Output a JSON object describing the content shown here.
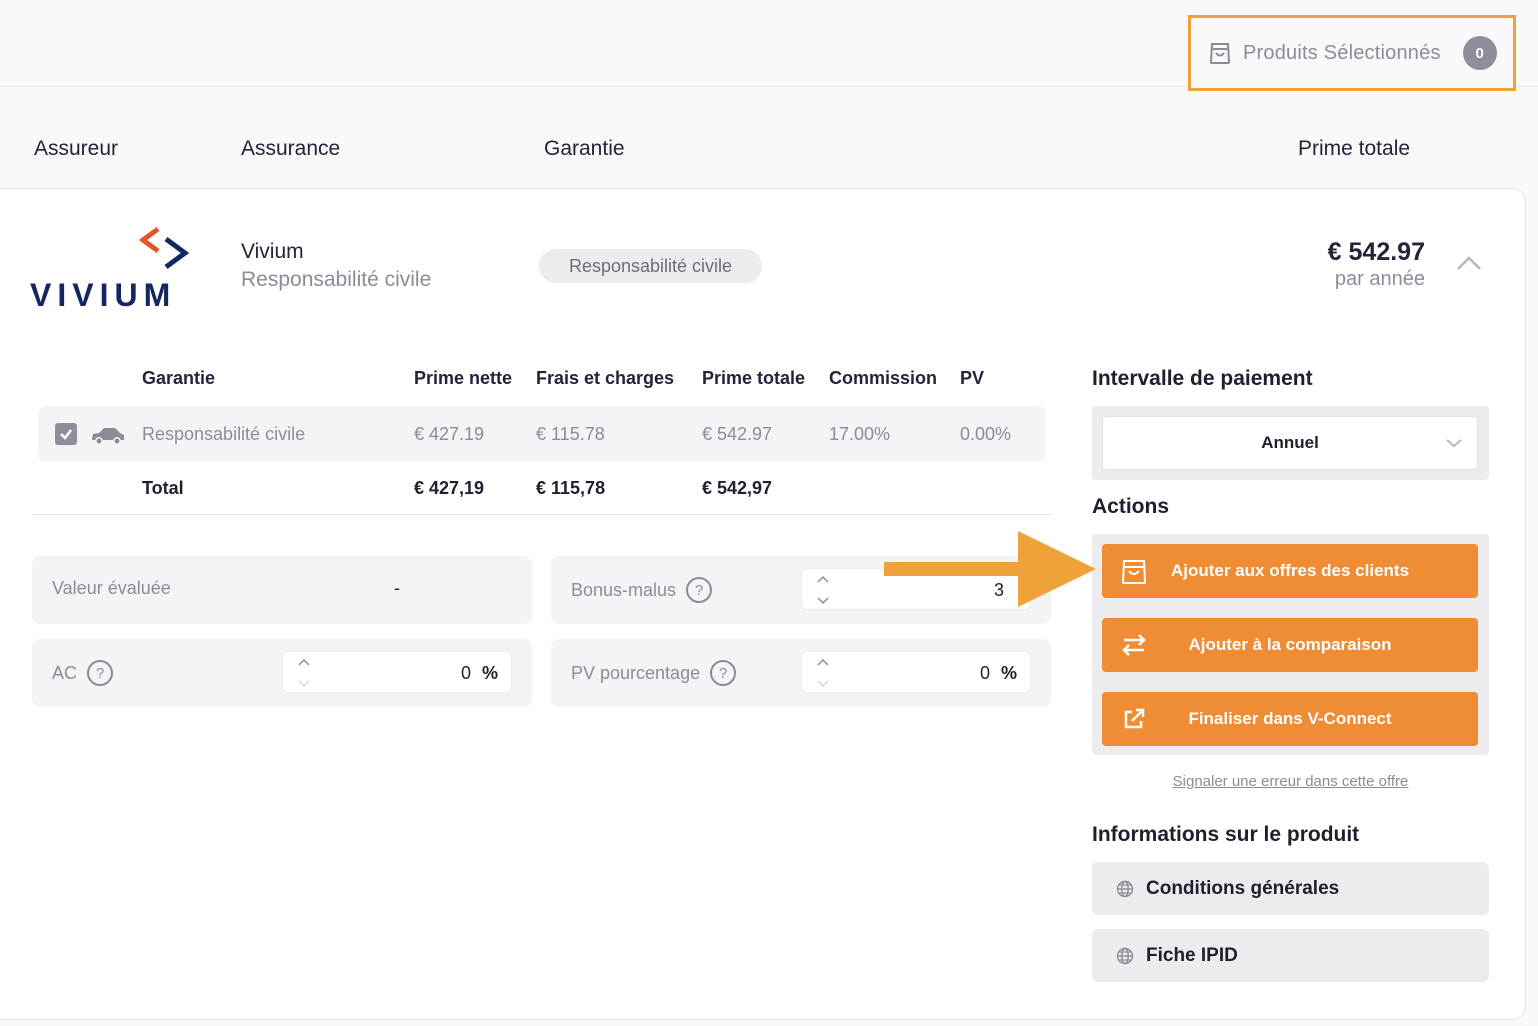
{
  "header": {
    "selected_products_label": "Produits Sélectionnés",
    "selected_products_count": "0",
    "highlight_color": "#f0a23a"
  },
  "columns": {
    "insurer": "Assureur",
    "insurance": "Assurance",
    "guarantee": "Garantie",
    "total_premium": "Prime totale"
  },
  "offer": {
    "logo_text": "VIVIUM",
    "insurer_name": "Vivium",
    "insurance_type": "Responsabilité civile",
    "guarantee_pill": "Responsabilité civile",
    "price": "€ 542.97",
    "price_period": "par année"
  },
  "guarantee_table": {
    "headers": [
      "Garantie",
      "Prime nette",
      "Frais et charges",
      "Prime totale",
      "Commission",
      "PV"
    ],
    "rows": [
      {
        "checked": true,
        "icon": "car-icon",
        "garantie": "Responsabilité civile",
        "prime_nette": "€ 427.19",
        "frais": "€ 115.78",
        "prime_totale": "€ 542.97",
        "commission": "17.00%",
        "pv": "0.00%"
      }
    ],
    "total": {
      "label": "Total",
      "prime_nette": "€ 427,19",
      "frais": "€ 115,78",
      "prime_totale": "€ 542,97"
    }
  },
  "fields": {
    "valeur_evaluee": {
      "label": "Valeur évaluée",
      "value": "-"
    },
    "bonus_malus": {
      "label": "Bonus-malus",
      "value": "3"
    },
    "ac": {
      "label": "AC",
      "value": "0",
      "unit": "%"
    },
    "pv_pourcentage": {
      "label": "PV pourcentage",
      "value": "0",
      "unit": "%"
    }
  },
  "payment": {
    "title": "Intervalle de paiement",
    "selected": "Annuel"
  },
  "actions": {
    "title": "Actions",
    "add_to_offers": "Ajouter aux offres des clients",
    "add_to_comparison": "Ajouter à la comparaison",
    "finalize": "Finaliser dans V-Connect",
    "report_error": "Signaler une erreur dans cette offre",
    "button_color": "#f08c34"
  },
  "product_info": {
    "title": "Informations sur le produit",
    "items": [
      "Conditions générales",
      "Fiche IPID"
    ]
  }
}
